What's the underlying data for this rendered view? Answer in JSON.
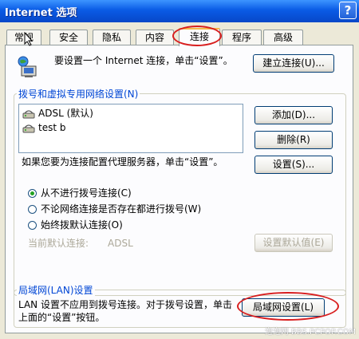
{
  "window": {
    "title": "Internet 选项",
    "help_label": "?"
  },
  "tabs": [
    {
      "label": "常规"
    },
    {
      "label": "安全"
    },
    {
      "label": "隐私"
    },
    {
      "label": "内容"
    },
    {
      "label": "连接"
    },
    {
      "label": "程序"
    },
    {
      "label": "高级"
    }
  ],
  "active_tab": "连接",
  "setup": {
    "text": "要设置一个 Internet 连接，单击“设置”。",
    "button": "建立连接(U)..."
  },
  "dialup": {
    "legend": "拨号和虚拟专用网络设置(N)",
    "items": [
      {
        "label": "ADSL (默认)"
      },
      {
        "label": "test b"
      }
    ],
    "add_button": "添加(D)...",
    "remove_button": "删除(R)",
    "settings_button": "设置(S)...",
    "proxy_text": "如果您要为连接配置代理服务器，单击“设置”。",
    "options": [
      {
        "label": "从不进行拨号连接(C)",
        "selected": true
      },
      {
        "label": "不论网络连接是否存在都进行拨号(W)",
        "selected": false
      },
      {
        "label": "始终拨默认连接(O)",
        "selected": false
      }
    ],
    "current_default_label": "当前默认连接:",
    "current_default_value": "ADSL",
    "set_default_button": "设置默认值(E)"
  },
  "lan": {
    "legend": "局域网(LAN)设置",
    "text": "LAN 设置不应用到拨号连接。对于拨号设置，单击上面的“设置”按钮。",
    "button": "局域网设置(L)"
  },
  "watermark": "泡泡网 BBS.PCPOP.COM",
  "colors": {
    "titlebar": "#0A5BE5",
    "highlight_ring": "#D81E1E",
    "legend_text": "#0046D5"
  }
}
